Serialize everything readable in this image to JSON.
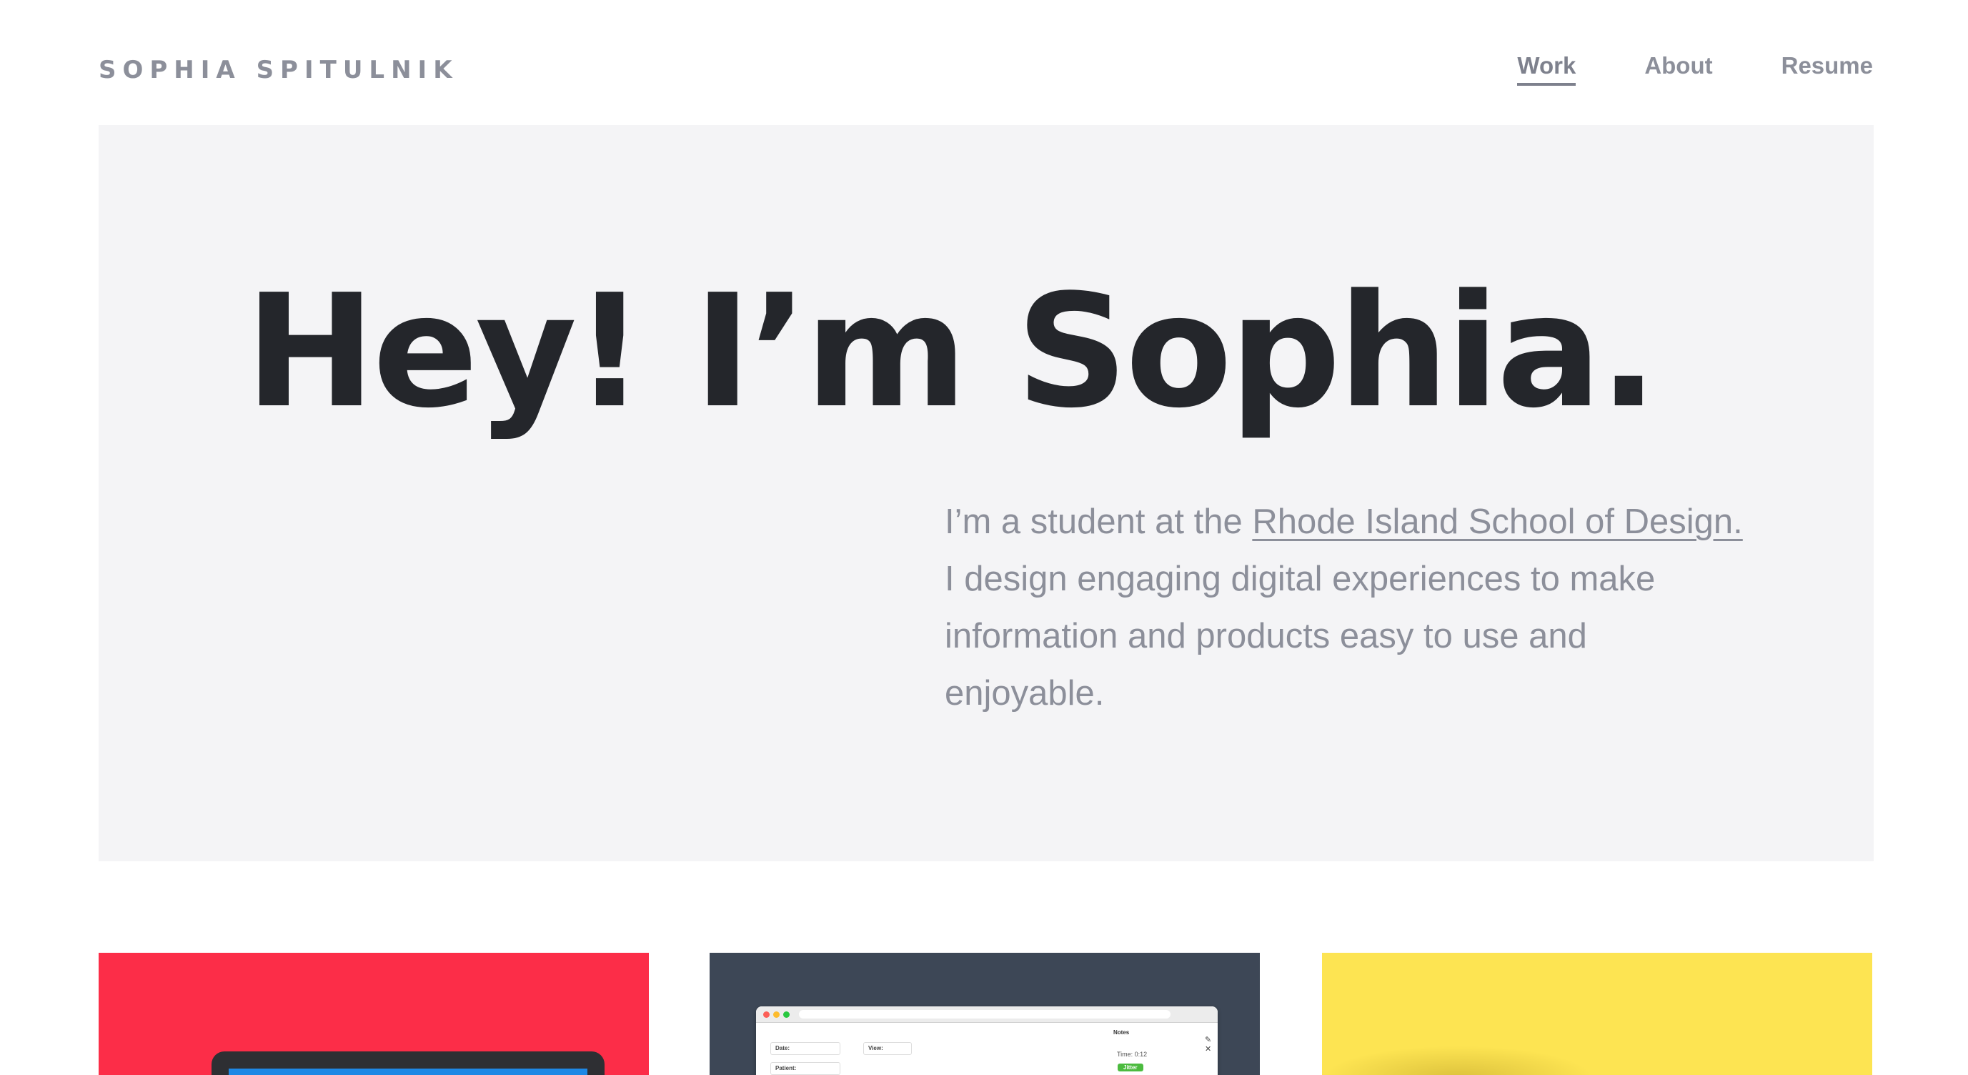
{
  "header": {
    "brand": "SOPHIA SPITULNIK",
    "nav": [
      {
        "label": "Work",
        "active": true
      },
      {
        "label": "About",
        "active": false
      },
      {
        "label": "Resume",
        "active": false
      }
    ]
  },
  "hero": {
    "title": "Hey! I’m Sophia.",
    "intro_before": "I’m a student at the ",
    "intro_link": "Rhode Island School of Design.",
    "intro_after": " I design engaging digital experiences to make information and products easy to use and enjoyable."
  },
  "projects": {
    "colors": {
      "red": "#fc2d48",
      "dark": "#3d4756",
      "yellow": "#fde452"
    },
    "app_preview": {
      "date_label": "Date:",
      "patient_label": "Patient:",
      "view_label": "View:",
      "notes_label": "Notes",
      "time_label": "Time: 0:12",
      "tag_label": "Jitter",
      "close_glyph": "✎ ✕"
    }
  }
}
